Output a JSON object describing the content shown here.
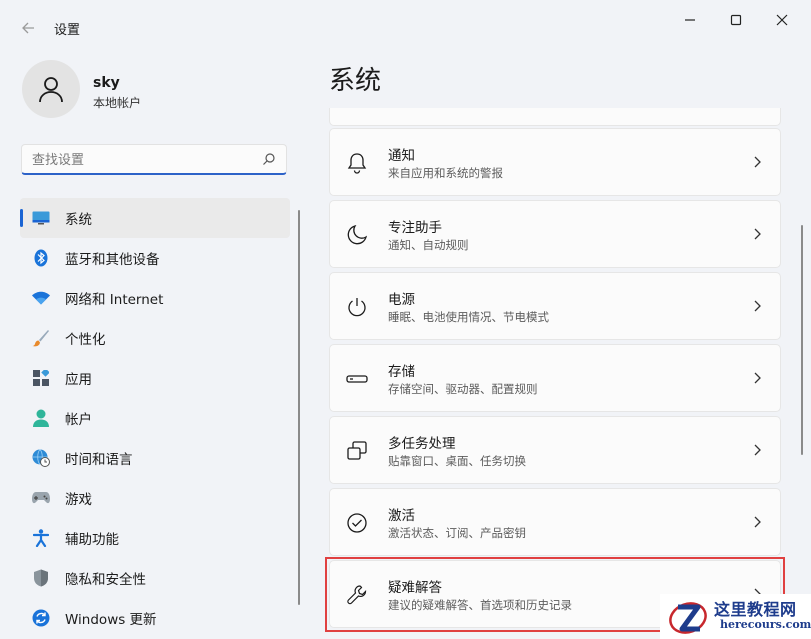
{
  "window": {
    "title": "设置",
    "controls": [
      "minimize-icon",
      "maximize-icon",
      "close-icon"
    ]
  },
  "profile": {
    "name": "sky",
    "account_type": "本地帐户"
  },
  "search": {
    "placeholder": "查找设置",
    "value": ""
  },
  "sidebar": {
    "items": [
      {
        "label": "系统",
        "icon": "system-display-icon",
        "active": true
      },
      {
        "label": "蓝牙和其他设备",
        "icon": "bluetooth-icon"
      },
      {
        "label": "网络和 Internet",
        "icon": "wifi-icon"
      },
      {
        "label": "个性化",
        "icon": "brush-icon"
      },
      {
        "label": "应用",
        "icon": "apps-icon"
      },
      {
        "label": "帐户",
        "icon": "account-icon"
      },
      {
        "label": "时间和语言",
        "icon": "globe-clock-icon"
      },
      {
        "label": "游戏",
        "icon": "gamepad-icon"
      },
      {
        "label": "辅助功能",
        "icon": "accessibility-icon"
      },
      {
        "label": "隐私和安全性",
        "icon": "shield-icon"
      },
      {
        "label": "Windows 更新",
        "icon": "windows-update-icon"
      }
    ]
  },
  "main": {
    "title": "系统",
    "cards": [
      {
        "title": "通知",
        "subtitle": "来自应用和系统的警报",
        "icon": "bell-icon"
      },
      {
        "title": "专注助手",
        "subtitle": "通知、自动规则",
        "icon": "moon-icon"
      },
      {
        "title": "电源",
        "subtitle": "睡眠、电池使用情况、节电模式",
        "icon": "power-icon"
      },
      {
        "title": "存储",
        "subtitle": "存储空间、驱动器、配置规则",
        "icon": "storage-drive-icon"
      },
      {
        "title": "多任务处理",
        "subtitle": "贴靠窗口、桌面、任务切换",
        "icon": "multitask-icon"
      },
      {
        "title": "激活",
        "subtitle": "激活状态、订阅、产品密钥",
        "icon": "check-circle-icon"
      },
      {
        "title": "疑难解答",
        "subtitle": "建议的疑难解答、首选项和历史记录",
        "icon": "wrench-icon"
      }
    ]
  },
  "watermark": {
    "name": "这里教程网",
    "url": "herecours.com"
  },
  "colors": {
    "accent": "#1a64d3",
    "highlight_border": "#e04040",
    "background": "#f1f3f7"
  }
}
